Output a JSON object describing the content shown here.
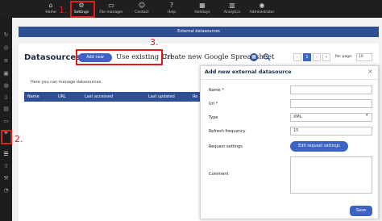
{
  "topnav": {
    "items": [
      {
        "label": "Home",
        "icon": "home-icon"
      },
      {
        "label": "Settings",
        "icon": "gear-icon"
      },
      {
        "label": "File manager",
        "icon": "folder-icon"
      },
      {
        "label": "Contact",
        "icon": "contact-icon"
      },
      {
        "label": "Help",
        "icon": "help-icon"
      },
      {
        "label": "Holidays",
        "icon": "calendar-icon"
      },
      {
        "label": "Analytics",
        "icon": "analytics-icon"
      },
      {
        "label": "Administrator",
        "icon": "user-icon"
      }
    ]
  },
  "banner": {
    "text": "External datasources"
  },
  "datasources": {
    "title": "Datasources",
    "add_new": "Add new",
    "use_existing": "Use existing Url",
    "create_google": "Create new Google Spreadsheet",
    "intro": "Here you can manage datasources.",
    "pager": {
      "current": "1"
    },
    "per_page_label": "Per page:",
    "per_page_value": "10",
    "columns": [
      "Name",
      "URL",
      "Last accessed",
      "Last updated",
      "Re"
    ]
  },
  "annotations": {
    "one": "1.",
    "two": "2.",
    "three": "3."
  },
  "modal": {
    "title": "Add new external datasource",
    "close": "×",
    "fields": {
      "name_label": "Name *",
      "url_label": "Url *",
      "type_label": "Type",
      "type_value": "XML",
      "refresh_label": "Refresh frequency",
      "refresh_value": "15",
      "request_label": "Request settings",
      "request_button": "Edit request settings",
      "comment_label": "Comment"
    },
    "save": "Save"
  },
  "colors": {
    "accent": "#3b64c4",
    "banner": "#2e4f93",
    "annotation": "#e21c1c",
    "nav": "#1f1f1f"
  }
}
